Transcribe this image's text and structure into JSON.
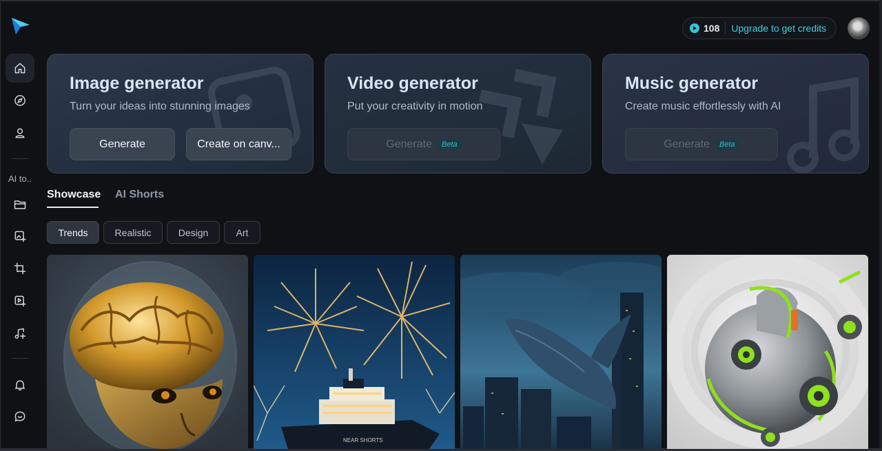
{
  "sidebar": {
    "section_label": "AI to..",
    "items": [
      {
        "name": "home",
        "icon": "home-icon"
      },
      {
        "name": "explore",
        "icon": "compass-icon"
      },
      {
        "name": "profile",
        "icon": "user-icon"
      },
      {
        "name": "folder",
        "icon": "folder-icon"
      },
      {
        "name": "image-tool",
        "icon": "image-plus-icon"
      },
      {
        "name": "crop-tool",
        "icon": "crop-icon"
      },
      {
        "name": "video-tool",
        "icon": "video-plus-icon"
      },
      {
        "name": "music-tool",
        "icon": "music-plus-icon"
      },
      {
        "name": "notifications",
        "icon": "bell-icon"
      },
      {
        "name": "feedback",
        "icon": "chat-icon"
      }
    ]
  },
  "header": {
    "credits_count": "108",
    "upgrade_label": "Upgrade to get credits"
  },
  "generators": [
    {
      "title": "Image generator",
      "subtitle": "Turn your ideas into stunning images",
      "primary_label": "Generate",
      "secondary_label": "Create on canv..."
    },
    {
      "title": "Video generator",
      "subtitle": "Put your creativity in motion",
      "primary_label": "Generate",
      "badge": "Beta"
    },
    {
      "title": "Music generator",
      "subtitle": "Create music effortlessly with AI",
      "primary_label": "Generate",
      "badge": "Beta"
    }
  ],
  "tabs": [
    {
      "label": "Showcase",
      "active": true
    },
    {
      "label": "AI Shorts",
      "active": false
    }
  ],
  "filters": [
    {
      "label": "Trends",
      "active": true
    },
    {
      "label": "Realistic",
      "active": false
    },
    {
      "label": "Design",
      "active": false
    },
    {
      "label": "Art",
      "active": false
    }
  ],
  "gallery": [
    {
      "subject": "golden brain robot head"
    },
    {
      "subject": "fireworks over cruise ship",
      "ship_text": "NEAR SHORTS"
    },
    {
      "subject": "whale flying over city skyline"
    },
    {
      "subject": "white and green mechanical sphere"
    }
  ],
  "colors": {
    "accent": "#3fd0e0",
    "background": "#0f1115",
    "card_border": "#3a4350"
  }
}
